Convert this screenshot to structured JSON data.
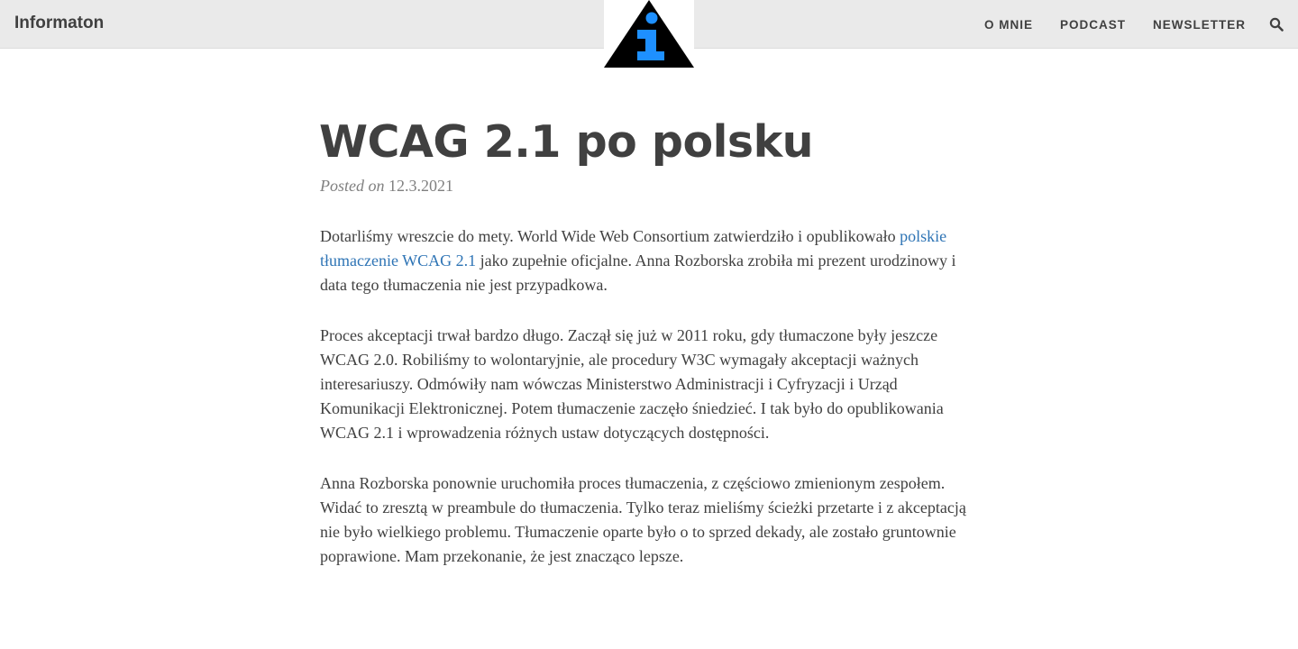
{
  "header": {
    "brand": "Informaton",
    "nav": [
      "O MNIE",
      "PODCAST",
      "NEWSLETTER"
    ],
    "search_icon": "search-icon",
    "logo_icon": "info-triangle-icon",
    "colors": {
      "bar": "#eaeaea",
      "logo_triangle": "#000000",
      "logo_glyph": "#1e90ff"
    }
  },
  "article": {
    "title": "WCAG 2.1 po polsku",
    "posted_label": "Posted on",
    "date": "12.3.2021",
    "p1": {
      "before": "Dotarliśmy wreszcie do mety. World Wide Web Consortium zatwierdziło i opublikowało ",
      "link": "polskie tłumaczenie WCAG 2.1",
      "after": " jako zupełnie oficjalne. Anna Rozborska zrobiła mi prezent urodzinowy i data tego tłumaczenia nie jest przypadkowa."
    },
    "p2": "Proces akceptacji trwał bardzo długo. Zaczął się już w 2011 roku, gdy tłumaczone były jeszcze WCAG 2.0. Robiliśmy to wolontaryjnie, ale procedury W3C wymagały akceptacji ważnych interesariuszy. Odmówiły nam wówczas Ministerstwo Administracji i Cyfryzacji i Urząd Komunikacji Elektronicznej. Potem tłumaczenie zaczęło śniedzieć. I tak było do opublikowania WCAG 2.1 i wprowadzenia różnych ustaw dotyczących dostępności.",
    "p3": "Anna Rozborska ponownie uruchomiła proces tłumaczenia, z częściowo zmienionym zespołem. Widać to zresztą w preambule do tłumaczenia. Tylko teraz mieliśmy ścieżki przetarte i z akceptacją nie było wielkiego problemu. Tłumaczenie oparte było o to sprzed dekady, ale zostało gruntownie poprawione. Mam przekonanie, że jest znacząco lepsze.",
    "link_color": "#2e74b5"
  }
}
